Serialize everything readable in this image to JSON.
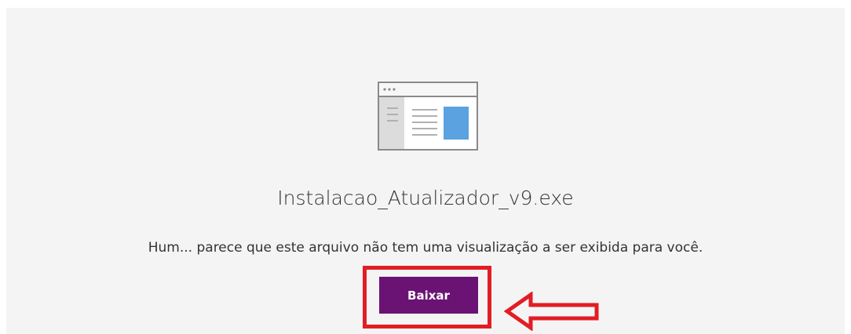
{
  "file": {
    "name": "Instalacao_Atualizador_v9.exe",
    "icon": "document-preview-icon"
  },
  "preview": {
    "message": "Hum... parece que este arquivo não tem uma visualização a ser exibida para você."
  },
  "actions": {
    "download_label": "Baixar"
  },
  "annotations": {
    "highlight_color": "#e21d24",
    "arrow_icon": "left-arrow-icon"
  },
  "colors": {
    "button_bg": "#6b1374",
    "panel_bg": "#f4f4f4",
    "icon_accent": "#5aa3e0"
  }
}
